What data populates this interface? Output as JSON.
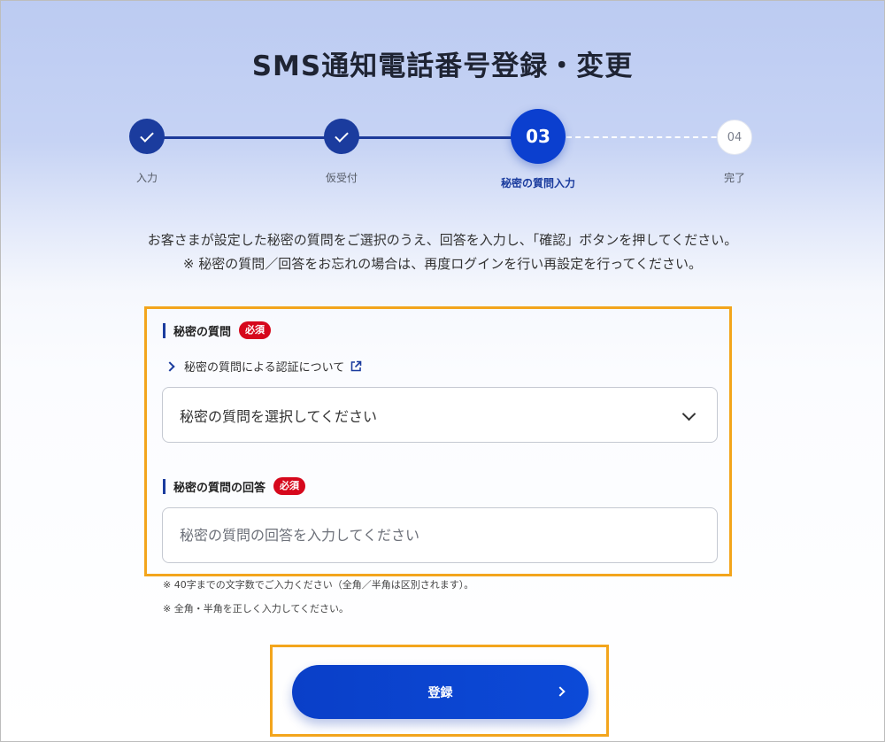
{
  "page": {
    "title": "SMS通知電話番号登録・変更"
  },
  "stepper": {
    "steps": [
      {
        "label": "入力",
        "state": "done"
      },
      {
        "label": "仮受付",
        "state": "done"
      },
      {
        "number": "03",
        "label": "秘密の質問入力",
        "state": "current"
      },
      {
        "number": "04",
        "label": "完了",
        "state": "todo"
      }
    ]
  },
  "instructions": {
    "line1": "お客さまが設定した秘密の質問をご選択のうえ、回答を入力し、「確認」ボタンを押してください。",
    "line2": "※ 秘密の質問／回答をお忘れの場合は、再度ログインを行い再設定を行ってください。"
  },
  "form": {
    "question_label": "秘密の質問",
    "required_badge": "必須",
    "help_link": "秘密の質問による認証について",
    "select_value": "秘密の質問を選択してください",
    "answer_label": "秘密の質問の回答",
    "answer_placeholder": "秘密の質問の回答を入力してください",
    "notes": [
      "※ 40字までの文字数でご入力ください（全角／半角は区別されます）。",
      "※ 全角・半角を正しく入力してください。"
    ]
  },
  "actions": {
    "submit_label": "登録"
  },
  "colors": {
    "primary": "#0b3fcf",
    "required": "#d6081c",
    "highlight": "#f3a51c"
  }
}
